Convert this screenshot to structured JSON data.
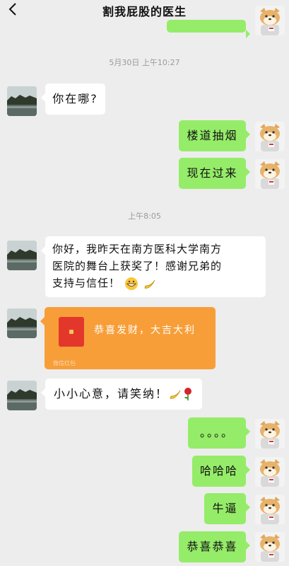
{
  "header": {
    "title": "割我屁股的医生",
    "back_icon": "chevron-left-icon",
    "more_icon": "more-dots-icon",
    "more_text": "···"
  },
  "colors": {
    "background": "#ededed",
    "incoming_bubble": "#ffffff",
    "outgoing_bubble": "#95ec69",
    "red_packet": "#f79e39"
  },
  "timestamps": {
    "t1": "5月30日 上午10:27",
    "t2": "上午8:05"
  },
  "messages": {
    "m1": "你在哪?",
    "m2": "楼道抽烟",
    "m3": "现在过来",
    "m4_line1": "你好，我昨天在南方医科大学南方",
    "m4_line2": "医院的舞台上获奖了！感谢兄弟的",
    "m4_line3": "支持与信任！",
    "m5": "小小心意，请笑纳！",
    "m6": "。。。。",
    "m7": "哈哈哈",
    "m8": "牛逼",
    "m9": "恭喜恭喜"
  },
  "red_packet": {
    "text": "恭喜发财，大吉大利",
    "footer": "微信红包"
  },
  "icons": {
    "grin": "grin-emoji-icon",
    "banana": "banana-emoji-icon",
    "rose": "rose-emoji-icon",
    "contact_avatar": "landscape-avatar",
    "self_avatar": "shiba-dog-avatar"
  }
}
